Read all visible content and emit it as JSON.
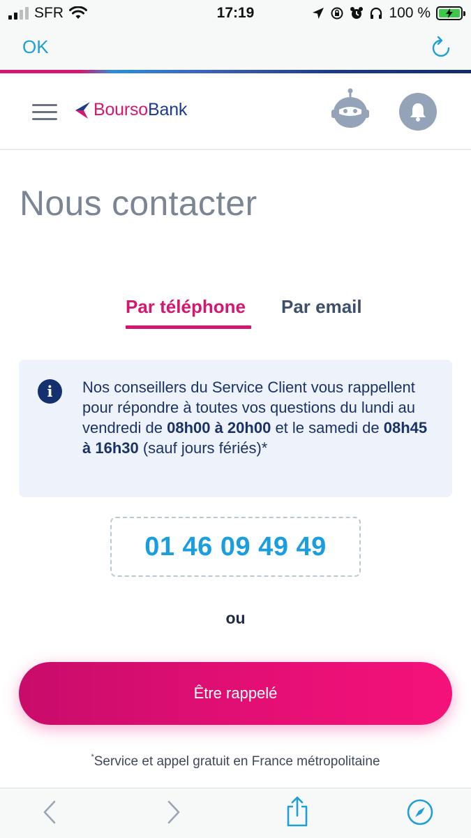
{
  "status_bar": {
    "carrier": "SFR",
    "time": "17:19",
    "battery": "100 %"
  },
  "browser": {
    "done_label": "OK"
  },
  "header": {
    "logo_bourso": "Bourso",
    "logo_bank": "Bank"
  },
  "page": {
    "title": "Nous contacter"
  },
  "tabs": [
    {
      "label": "Par téléphone",
      "active": true
    },
    {
      "label": "Par email",
      "active": false
    }
  ],
  "info": {
    "icon": "i",
    "part1": "Nos conseillers du Service Client vous rappellent pour répondre à toutes vos questions du lundi au vendredi de ",
    "weekday_hours": "08h00 à 20h00",
    "part2": " et le samedi de ",
    "saturday_hours": "08h45 à 16h30",
    "part3": " (sauf jours fériés)*"
  },
  "phone": {
    "number": "01 46 09 49 49"
  },
  "or_label": "ou",
  "callback": {
    "label": "Être rappelé"
  },
  "footnote": {
    "star": "*",
    "text": "Service et appel gratuit en France métropolitaine"
  },
  "colors": {
    "brand_pink": "#d41771",
    "brand_blue": "#1d3b8c",
    "phone_blue": "#1a9ee0",
    "info_bg": "#eef3fb"
  },
  "icons": {
    "bot": "robot-assistant-icon",
    "bell": "bell-icon",
    "menu": "hamburger-icon",
    "back": "chevron-left-icon",
    "forward": "chevron-right-icon",
    "share": "share-icon",
    "safari": "compass-icon",
    "reload": "reload-icon"
  }
}
